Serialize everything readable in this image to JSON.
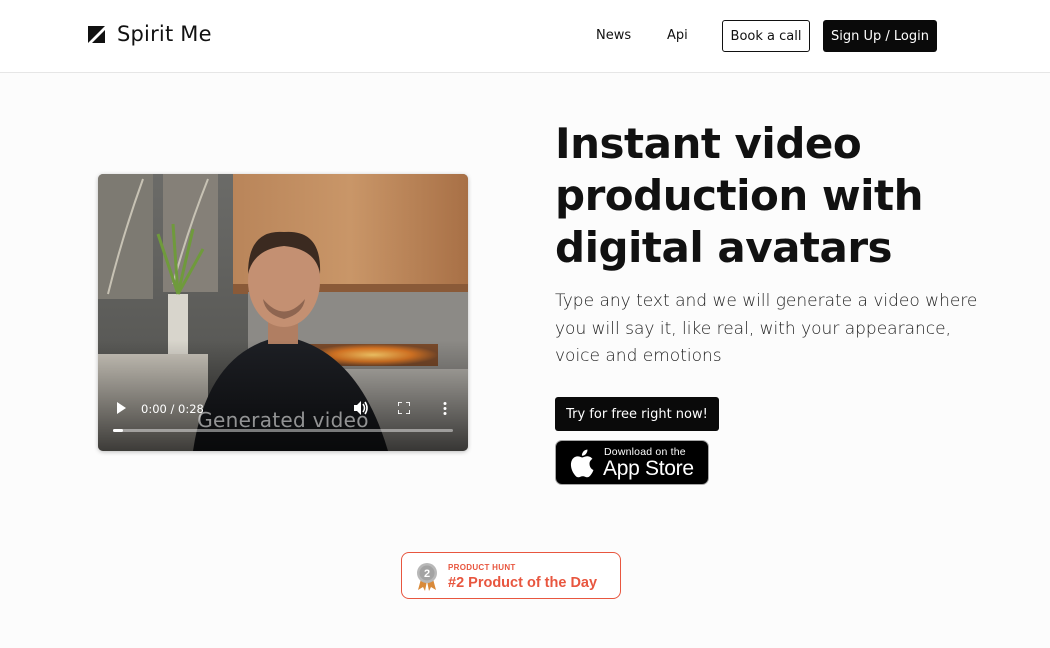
{
  "header": {
    "brand": "Spirit Me",
    "nav": [
      {
        "label": "News"
      },
      {
        "label": "Api"
      }
    ],
    "book_call_label": "Book a call",
    "signup_label": "Sign Up / Login"
  },
  "video": {
    "time": "0:00 / 0:28",
    "caption": "Generated video",
    "progress": 0.03
  },
  "hero": {
    "title": "Instant video production with digital avatars",
    "subtitle": "Type any text and we will generate a video where you will say it, like real, with your appearance, voice and emotions",
    "cta_label": "Try for free right now!"
  },
  "appstore": {
    "small": "Download on the",
    "big": "App Store"
  },
  "product_hunt": {
    "eyebrow": "PRODUCT HUNT",
    "title": "#2 Product of the Day",
    "rank": "2"
  },
  "colors": {
    "accent": "#e8563f",
    "dark": "#0a0a0a"
  }
}
